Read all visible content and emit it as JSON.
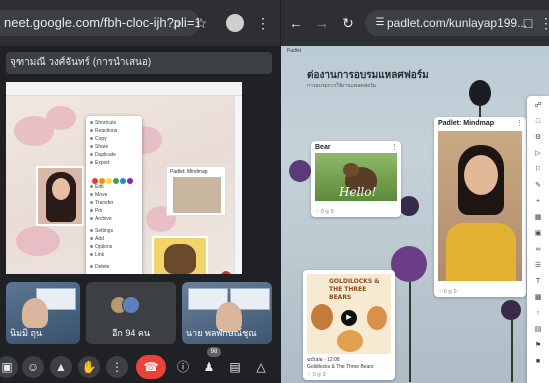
{
  "left_window": {
    "url": "neet.google.com/fbh-cloc-ijh?pli=1",
    "presenter_name": "จุฑามณี วงศ์จันทร์ (การนำเสนอ)",
    "participants": {
      "others_label": "อีก 94 คน",
      "people_count": "98"
    },
    "tiles": [
      {
        "name": "นิมมิ ถุน"
      },
      {
        "name": "นาย พลพักษณ์ชุณ"
      }
    ]
  },
  "right_window": {
    "url": "padlet.com/kunlayap199...",
    "padlet": {
      "brand": "Padlet",
      "title": "ต่องานการอบรมแหลศฟอร์ม",
      "subtitle": "การอบรมการใช้งานแพลตฟอร์ม"
    },
    "posts": [
      {
        "title": "Bear",
        "image_caption": "Hello!",
        "footer": "♡ 0  ◎ 0"
      },
      {
        "title": "Padlet: Mindmap",
        "footer": "♡ 0  ◎ 0"
      },
      {
        "title": "GOLDILOCKS & THE THREE BEARS",
        "meta": "ฉบับย่อ - 12:08",
        "description": "Goldilocks & The Three Bears",
        "footer": "♡ 0  ◎ 0"
      }
    ]
  },
  "colors": {
    "meet_end_call": "#ea4335",
    "browser_chrome": "#2d2f33",
    "meet_bg": "#202124"
  }
}
